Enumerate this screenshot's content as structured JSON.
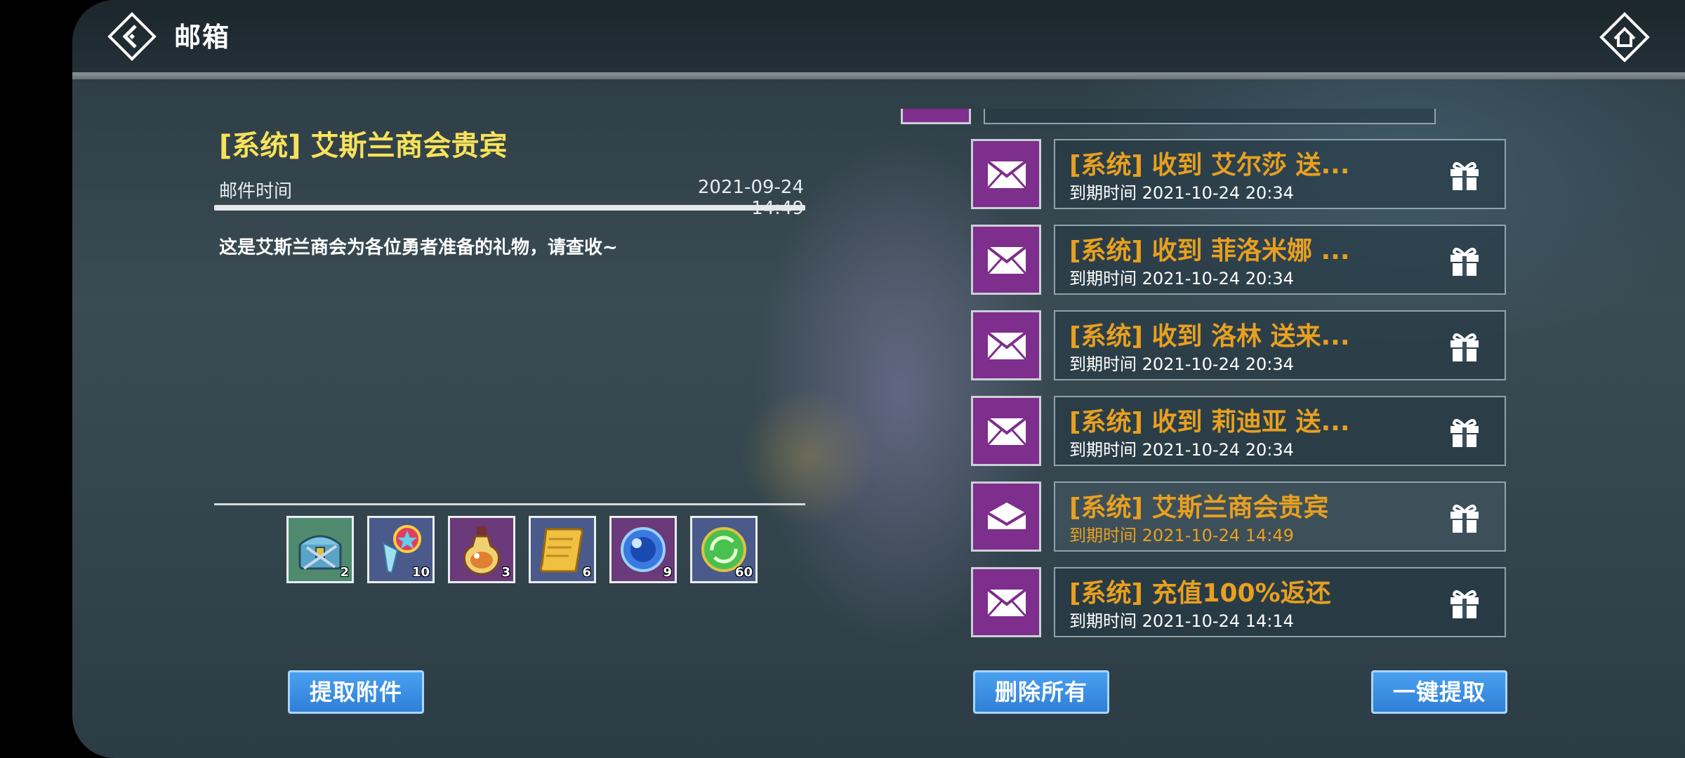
{
  "header": {
    "title": "邮箱"
  },
  "detail": {
    "title": "[系统] 艾斯兰商会贵宾",
    "time_label": "邮件时间",
    "time_value": "2021-09-24 14:49",
    "body": "这是艾斯兰商会为各位勇者准备的礼物，请查收~",
    "attachments": [
      {
        "icon": "treasure-chest-icon",
        "count": "2"
      },
      {
        "icon": "crystal-scroll-icon",
        "count": "10"
      },
      {
        "icon": "potion-icon",
        "count": "3"
      },
      {
        "icon": "scroll-icon",
        "count": "6"
      },
      {
        "icon": "blue-orb-icon",
        "count": "9"
      },
      {
        "icon": "green-orb-icon",
        "count": "60"
      }
    ],
    "claim_label": "提取附件"
  },
  "mail_list": [
    {
      "title": "[系统] 收到 艾尔莎 送...",
      "expiry": "到期时间 2021-10-24 20:34",
      "opened": false
    },
    {
      "title": "[系统] 收到 菲洛米娜 ...",
      "expiry": "到期时间 2021-10-24 20:34",
      "opened": false
    },
    {
      "title": "[系统] 收到 洛林 送来...",
      "expiry": "到期时间 2021-10-24 20:34",
      "opened": false
    },
    {
      "title": "[系统] 收到 莉迪亚 送...",
      "expiry": "到期时间 2021-10-24 20:34",
      "opened": false
    },
    {
      "title": "[系统] 艾斯兰商会贵宾",
      "expiry": "到期时间 2021-10-24 14:49",
      "opened": true
    },
    {
      "title": "[系统] 充值100%返还",
      "expiry": "到期时间 2021-10-24 14:14",
      "opened": false
    }
  ],
  "actions": {
    "delete_all": "删除所有",
    "claim_all": "一键提取"
  },
  "colors": {
    "accent_yellow": "#f7e25a",
    "mail_title_orange": "#e8a020",
    "mail_icon_purple": "#7e2e8c",
    "button_blue": "#3a8ee6"
  }
}
